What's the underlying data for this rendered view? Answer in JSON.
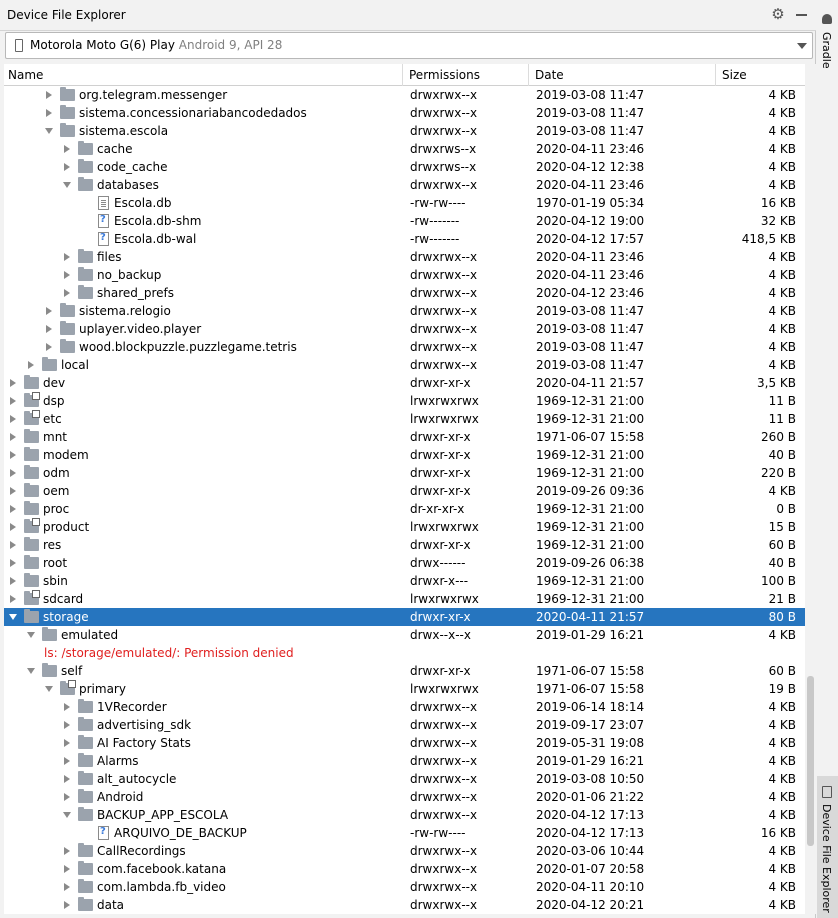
{
  "panel": {
    "title": "Device File Explorer",
    "gear_icon": "gear-icon",
    "minimize_icon": "minimize-icon"
  },
  "device": {
    "name": "Motorola Moto G(6) Play",
    "api": "Android 9, API 28"
  },
  "columns": [
    "Name",
    "Permissions",
    "Date",
    "Size"
  ],
  "rows": [
    {
      "indent": 2,
      "arrow": "right",
      "icon": "folder",
      "name": "org.telegram.messenger",
      "perm": "drwxrwx--x",
      "date": "2019-03-08 11:47",
      "size": "4 KB"
    },
    {
      "indent": 2,
      "arrow": "right",
      "icon": "folder",
      "name": "sistema.concessionariabancodedados",
      "perm": "drwxrwx--x",
      "date": "2019-03-08 11:47",
      "size": "4 KB"
    },
    {
      "indent": 2,
      "arrow": "down",
      "icon": "folder",
      "name": "sistema.escola",
      "perm": "drwxrwx--x",
      "date": "2019-03-08 11:47",
      "size": "4 KB"
    },
    {
      "indent": 3,
      "arrow": "right",
      "icon": "folder",
      "name": "cache",
      "perm": "drwxrws--x",
      "date": "2020-04-11 23:46",
      "size": "4 KB"
    },
    {
      "indent": 3,
      "arrow": "right",
      "icon": "folder",
      "name": "code_cache",
      "perm": "drwxrws--x",
      "date": "2020-04-12 12:38",
      "size": "4 KB"
    },
    {
      "indent": 3,
      "arrow": "down",
      "icon": "folder",
      "name": "databases",
      "perm": "drwxrwx--x",
      "date": "2020-04-11 23:46",
      "size": "4 KB"
    },
    {
      "indent": 4,
      "arrow": "none",
      "icon": "file",
      "name": "Escola.db",
      "perm": "-rw-rw----",
      "date": "1970-01-19 05:34",
      "size": "16 KB"
    },
    {
      "indent": 4,
      "arrow": "none",
      "icon": "unknown",
      "name": "Escola.db-shm",
      "perm": "-rw-------",
      "date": "2020-04-12 19:00",
      "size": "32 KB"
    },
    {
      "indent": 4,
      "arrow": "none",
      "icon": "unknown",
      "name": "Escola.db-wal",
      "perm": "-rw-------",
      "date": "2020-04-12 17:57",
      "size": "418,5 KB"
    },
    {
      "indent": 3,
      "arrow": "right",
      "icon": "folder",
      "name": "files",
      "perm": "drwxrwx--x",
      "date": "2020-04-11 23:46",
      "size": "4 KB"
    },
    {
      "indent": 3,
      "arrow": "right",
      "icon": "folder",
      "name": "no_backup",
      "perm": "drwxrwx--x",
      "date": "2020-04-11 23:46",
      "size": "4 KB"
    },
    {
      "indent": 3,
      "arrow": "right",
      "icon": "folder",
      "name": "shared_prefs",
      "perm": "drwxrwx--x",
      "date": "2020-04-12 23:46",
      "size": "4 KB"
    },
    {
      "indent": 2,
      "arrow": "right",
      "icon": "folder",
      "name": "sistema.relogio",
      "perm": "drwxrwx--x",
      "date": "2019-03-08 11:47",
      "size": "4 KB"
    },
    {
      "indent": 2,
      "arrow": "right",
      "icon": "folder",
      "name": "uplayer.video.player",
      "perm": "drwxrwx--x",
      "date": "2019-03-08 11:47",
      "size": "4 KB"
    },
    {
      "indent": 2,
      "arrow": "right",
      "icon": "folder",
      "name": "wood.blockpuzzle.puzzlegame.tetris",
      "perm": "drwxrwx--x",
      "date": "2019-03-08 11:47",
      "size": "4 KB"
    },
    {
      "indent": 1,
      "arrow": "right",
      "icon": "folder",
      "name": "local",
      "perm": "drwxrwx--x",
      "date": "2019-03-08 11:47",
      "size": "4 KB"
    },
    {
      "indent": 0,
      "arrow": "right",
      "icon": "folder",
      "name": "dev",
      "perm": "drwxr-xr-x",
      "date": "2020-04-11 21:57",
      "size": "3,5 KB"
    },
    {
      "indent": 0,
      "arrow": "right",
      "icon": "link",
      "name": "dsp",
      "perm": "lrwxrwxrwx",
      "date": "1969-12-31 21:00",
      "size": "11 B"
    },
    {
      "indent": 0,
      "arrow": "right",
      "icon": "link",
      "name": "etc",
      "perm": "lrwxrwxrwx",
      "date": "1969-12-31 21:00",
      "size": "11 B"
    },
    {
      "indent": 0,
      "arrow": "right",
      "icon": "folder",
      "name": "mnt",
      "perm": "drwxr-xr-x",
      "date": "1971-06-07 15:58",
      "size": "260 B"
    },
    {
      "indent": 0,
      "arrow": "right",
      "icon": "folder",
      "name": "modem",
      "perm": "drwxr-xr-x",
      "date": "1969-12-31 21:00",
      "size": "40 B"
    },
    {
      "indent": 0,
      "arrow": "right",
      "icon": "folder",
      "name": "odm",
      "perm": "drwxr-xr-x",
      "date": "1969-12-31 21:00",
      "size": "220 B"
    },
    {
      "indent": 0,
      "arrow": "right",
      "icon": "folder",
      "name": "oem",
      "perm": "drwxr-xr-x",
      "date": "2019-09-26 09:36",
      "size": "4 KB"
    },
    {
      "indent": 0,
      "arrow": "right",
      "icon": "folder",
      "name": "proc",
      "perm": "dr-xr-xr-x",
      "date": "1969-12-31 21:00",
      "size": "0 B"
    },
    {
      "indent": 0,
      "arrow": "right",
      "icon": "link",
      "name": "product",
      "perm": "lrwxrwxrwx",
      "date": "1969-12-31 21:00",
      "size": "15 B"
    },
    {
      "indent": 0,
      "arrow": "right",
      "icon": "folder",
      "name": "res",
      "perm": "drwxr-xr-x",
      "date": "1969-12-31 21:00",
      "size": "60 B"
    },
    {
      "indent": 0,
      "arrow": "right",
      "icon": "folder",
      "name": "root",
      "perm": "drwx------",
      "date": "2019-09-26 06:38",
      "size": "40 B"
    },
    {
      "indent": 0,
      "arrow": "right",
      "icon": "folder",
      "name": "sbin",
      "perm": "drwxr-x---",
      "date": "1969-12-31 21:00",
      "size": "100 B"
    },
    {
      "indent": 0,
      "arrow": "right",
      "icon": "link",
      "name": "sdcard",
      "perm": "lrwxrwxrwx",
      "date": "1969-12-31 21:00",
      "size": "21 B"
    },
    {
      "indent": 0,
      "arrow": "down",
      "icon": "folder",
      "name": "storage",
      "perm": "drwxr-xr-x",
      "date": "2020-04-11 21:57",
      "size": "80 B",
      "selected": true
    },
    {
      "indent": 1,
      "arrow": "down",
      "icon": "folder",
      "name": "emulated",
      "perm": "drwx--x--x",
      "date": "2019-01-29 16:21",
      "size": "4 KB"
    },
    {
      "indent": 2,
      "arrow": "none",
      "icon": "none",
      "name": "ls: /storage/emulated/: Permission denied",
      "perm": "",
      "date": "",
      "size": "",
      "error": true
    },
    {
      "indent": 1,
      "arrow": "down",
      "icon": "folder",
      "name": "self",
      "perm": "drwxr-xr-x",
      "date": "1971-06-07 15:58",
      "size": "60 B"
    },
    {
      "indent": 2,
      "arrow": "down",
      "icon": "link",
      "name": "primary",
      "perm": "lrwxrwxrwx",
      "date": "1971-06-07 15:58",
      "size": "19 B"
    },
    {
      "indent": 3,
      "arrow": "right",
      "icon": "folder",
      "name": "1VRecorder",
      "perm": "drwxrwx--x",
      "date": "2019-06-14 18:14",
      "size": "4 KB"
    },
    {
      "indent": 3,
      "arrow": "right",
      "icon": "folder",
      "name": "advertising_sdk",
      "perm": "drwxrwx--x",
      "date": "2019-09-17 23:07",
      "size": "4 KB"
    },
    {
      "indent": 3,
      "arrow": "right",
      "icon": "folder",
      "name": "AI Factory Stats",
      "perm": "drwxrwx--x",
      "date": "2019-05-31 19:08",
      "size": "4 KB"
    },
    {
      "indent": 3,
      "arrow": "right",
      "icon": "folder",
      "name": "Alarms",
      "perm": "drwxrwx--x",
      "date": "2019-01-29 16:21",
      "size": "4 KB"
    },
    {
      "indent": 3,
      "arrow": "right",
      "icon": "folder",
      "name": "alt_autocycle",
      "perm": "drwxrwx--x",
      "date": "2019-03-08 10:50",
      "size": "4 KB"
    },
    {
      "indent": 3,
      "arrow": "right",
      "icon": "folder",
      "name": "Android",
      "perm": "drwxrwx--x",
      "date": "2020-01-06 21:22",
      "size": "4 KB"
    },
    {
      "indent": 3,
      "arrow": "down",
      "icon": "folder",
      "name": "BACKUP_APP_ESCOLA",
      "perm": "drwxrwx--x",
      "date": "2020-04-12 17:13",
      "size": "4 KB"
    },
    {
      "indent": 4,
      "arrow": "none",
      "icon": "unknown",
      "name": "ARQUIVO_DE_BACKUP",
      "perm": "-rw-rw----",
      "date": "2020-04-12 17:13",
      "size": "16 KB"
    },
    {
      "indent": 3,
      "arrow": "right",
      "icon": "folder",
      "name": "CallRecordings",
      "perm": "drwxrwx--x",
      "date": "2020-03-06 10:44",
      "size": "4 KB"
    },
    {
      "indent": 3,
      "arrow": "right",
      "icon": "folder",
      "name": "com.facebook.katana",
      "perm": "drwxrwx--x",
      "date": "2020-01-07 20:58",
      "size": "4 KB"
    },
    {
      "indent": 3,
      "arrow": "right",
      "icon": "folder",
      "name": "com.lambda.fb_video",
      "perm": "drwxrwx--x",
      "date": "2020-04-11 20:10",
      "size": "4 KB"
    },
    {
      "indent": 3,
      "arrow": "right",
      "icon": "folder",
      "name": "data",
      "perm": "drwxrwx--x",
      "date": "2020-04-12 20:21",
      "size": "4 KB"
    }
  ],
  "sidebar": {
    "gradle_label": "Gradle",
    "explorer_label": "Device File Explorer"
  },
  "colors": {
    "selection": "#2675bf",
    "error": "#e01e1e"
  }
}
